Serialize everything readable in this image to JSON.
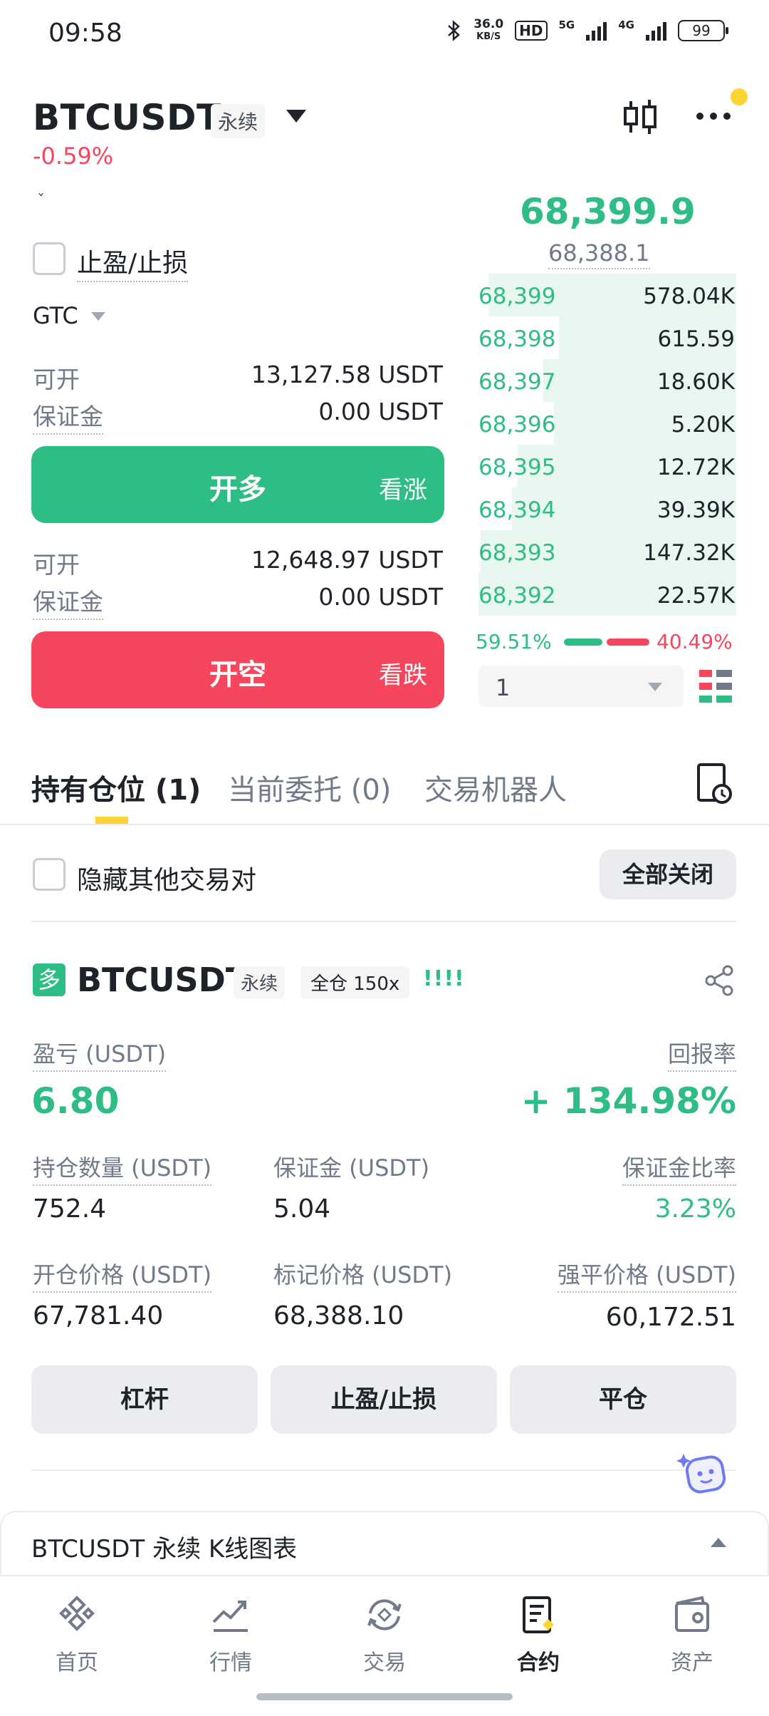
{
  "status_bar": {
    "time": "09:58",
    "speed_value": "36.0",
    "speed_unit": "KB/S",
    "hd": "HD",
    "net1": "5G",
    "net2": "4G",
    "battery": "99"
  },
  "header": {
    "symbol": "BTCUSDT",
    "contract_tag": "永续",
    "change": "-0.59%"
  },
  "order_form": {
    "tpsl_label": "止盈/止损",
    "tif": "GTC",
    "long": {
      "available_label": "可开",
      "available_value": "13,127.58 USDT",
      "margin_label": "保证金",
      "margin_value": "0.00 USDT",
      "button": "开多",
      "button_sub": "看涨"
    },
    "short": {
      "available_label": "可开",
      "available_value": "12,648.97 USDT",
      "margin_label": "保证金",
      "margin_value": "0.00 USDT",
      "button": "开空",
      "button_sub": "看跌"
    }
  },
  "orderbook": {
    "last_price": "68,399.9",
    "mark_price": "68,388.1",
    "rows": [
      {
        "price": "68,399",
        "qty": "578.04K",
        "depth": 0.95
      },
      {
        "price": "68,398",
        "qty": "615.59",
        "depth": 0.68
      },
      {
        "price": "68,397",
        "qty": "18.60K",
        "depth": 0.74
      },
      {
        "price": "68,396",
        "qty": "5.20K",
        "depth": 0.7
      },
      {
        "price": "68,395",
        "qty": "12.72K",
        "depth": 0.84
      },
      {
        "price": "68,394",
        "qty": "39.39K",
        "depth": 0.86
      },
      {
        "price": "68,393",
        "qty": "147.32K",
        "depth": 0.98
      },
      {
        "price": "68,392",
        "qty": "22.57K",
        "depth": 0.99
      }
    ],
    "buy_ratio": "59.51%",
    "sell_ratio": "40.49%",
    "depth_step": "1"
  },
  "tabs": {
    "positions": "持有仓位 (1)",
    "orders": "当前委托 (0)",
    "bots": "交易机器人"
  },
  "filters": {
    "hide_others": "隐藏其他交易对",
    "close_all": "全部关闭"
  },
  "position": {
    "side": "多",
    "symbol": "BTCUSDT",
    "contract_tag": "永续",
    "margin_tag": "全仓 150x",
    "strength": "!!!!",
    "pnl_label": "盈亏 (USDT)",
    "pnl_value": "6.80",
    "roe_label": "回报率",
    "roe_value": "+ 134.98%",
    "size_label": "持仓数量 (USDT)",
    "size_value": "752.4",
    "margin_label": "保证金 (USDT)",
    "margin_value": "5.04",
    "margin_ratio_label": "保证金比率",
    "margin_ratio_value": "3.23%",
    "entry_label": "开仓价格 (USDT)",
    "entry_value": "67,781.40",
    "mark_label": "标记价格 (USDT)",
    "mark_value": "68,388.10",
    "liq_label": "强平价格 (USDT)",
    "liq_value": "60,172.51",
    "btn_leverage": "杠杆",
    "btn_tpsl": "止盈/止损",
    "btn_close": "平仓"
  },
  "kline_drawer": {
    "title": "BTCUSDT 永续 K线图表"
  },
  "nav": {
    "home": "首页",
    "markets": "行情",
    "trade": "交易",
    "futures": "合约",
    "assets": "资产"
  },
  "colors": {
    "green": "#2ebd85",
    "red": "#f6465d",
    "accent": "#fcd535"
  }
}
